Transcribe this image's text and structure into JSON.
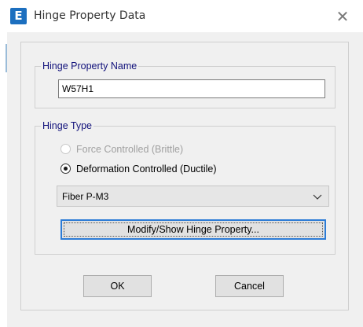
{
  "window": {
    "app_icon_letter": "E",
    "title": "Hinge Property Data",
    "close_symbol": "✕"
  },
  "hinge_property_name": {
    "legend": "Hinge Property Name",
    "value": "W57H1"
  },
  "hinge_type": {
    "legend": "Hinge Type",
    "options": [
      {
        "label": "Force Controlled  (Brittle)",
        "selected": false,
        "enabled": false
      },
      {
        "label": "Deformation Controlled  (Ductile)",
        "selected": true,
        "enabled": true
      }
    ],
    "dropdown_value": "Fiber P-M3",
    "modify_button_label": "Modify/Show Hinge Property..."
  },
  "buttons": {
    "ok_label": "OK",
    "cancel_label": "Cancel"
  },
  "colors": {
    "legend_text": "#10107a",
    "focus_border": "#2d7cd6",
    "app_icon_bg": "#1c6fbf"
  }
}
